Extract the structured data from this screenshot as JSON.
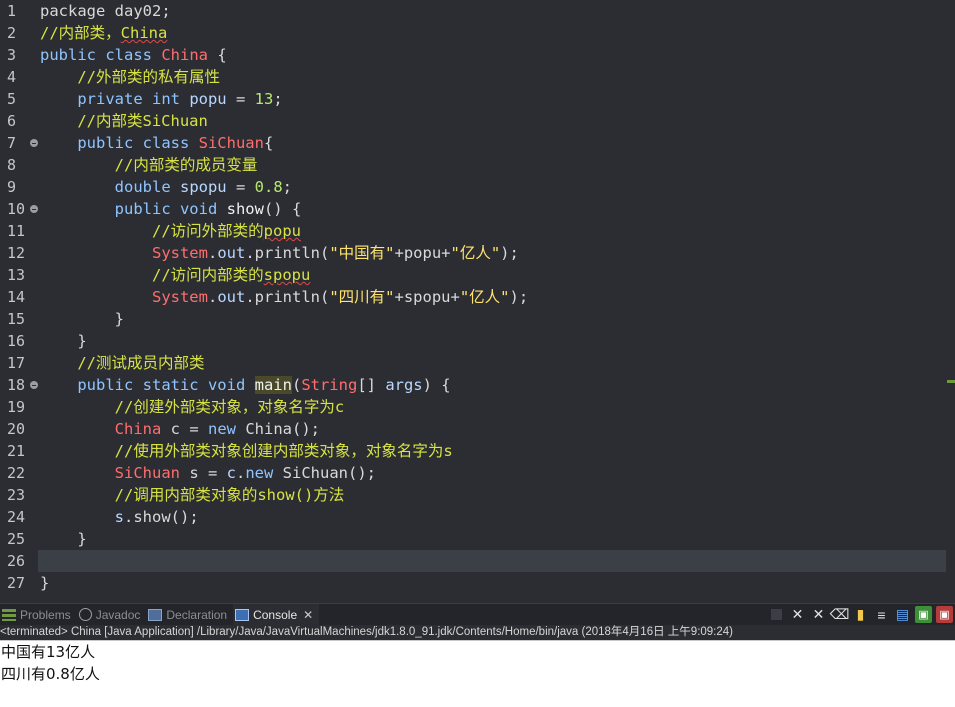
{
  "editor": {
    "lines": [
      {
        "n": "1",
        "tokens": [
          {
            "t": "package day02;",
            "c": "pl"
          }
        ]
      },
      {
        "n": "2",
        "tokens": [
          {
            "t": "//内部类，",
            "c": "cm"
          },
          {
            "t": "China",
            "c": "cm ul"
          }
        ]
      },
      {
        "n": "3",
        "tokens": [
          {
            "t": "public class ",
            "c": "kw"
          },
          {
            "t": "China",
            "c": "cls"
          },
          {
            "t": " {",
            "c": "pl"
          }
        ]
      },
      {
        "n": "4",
        "tokens": [
          {
            "t": "    //外部类的私有属性",
            "c": "cm"
          }
        ]
      },
      {
        "n": "5",
        "tokens": [
          {
            "t": "    private int ",
            "c": "kw"
          },
          {
            "t": "popu",
            "c": "var"
          },
          {
            "t": " = ",
            "c": "pl"
          },
          {
            "t": "13",
            "c": "num"
          },
          {
            "t": ";",
            "c": "pl"
          }
        ]
      },
      {
        "n": "6",
        "tokens": [
          {
            "t": "    //内部类SiChuan",
            "c": "cm"
          }
        ]
      },
      {
        "n": "7",
        "fold": true,
        "tokens": [
          {
            "t": "    public class ",
            "c": "kw"
          },
          {
            "t": "SiChuan",
            "c": "cls"
          },
          {
            "t": "{",
            "c": "pl"
          }
        ]
      },
      {
        "n": "8",
        "tokens": [
          {
            "t": "        //内部类的成员变量",
            "c": "cm"
          }
        ]
      },
      {
        "n": "9",
        "tokens": [
          {
            "t": "        double ",
            "c": "kw"
          },
          {
            "t": "spopu",
            "c": "var"
          },
          {
            "t": " = ",
            "c": "pl"
          },
          {
            "t": "0.8",
            "c": "num"
          },
          {
            "t": ";",
            "c": "pl"
          }
        ]
      },
      {
        "n": "10",
        "fold": true,
        "tokens": [
          {
            "t": "        public void ",
            "c": "kw"
          },
          {
            "t": "show",
            "c": "fn"
          },
          {
            "t": "() {",
            "c": "pl"
          }
        ]
      },
      {
        "n": "11",
        "tokens": [
          {
            "t": "            //访问外部类的",
            "c": "cm"
          },
          {
            "t": "popu",
            "c": "cm ul"
          }
        ]
      },
      {
        "n": "12",
        "tokens": [
          {
            "t": "            ",
            "c": "pl"
          },
          {
            "t": "System",
            "c": "cls"
          },
          {
            "t": ".",
            "c": "pl"
          },
          {
            "t": "out",
            "c": "var"
          },
          {
            "t": ".println(",
            "c": "pl"
          },
          {
            "t": "\"中国有\"",
            "c": "str"
          },
          {
            "t": "+popu+",
            "c": "pl"
          },
          {
            "t": "\"亿人\"",
            "c": "str"
          },
          {
            "t": ");",
            "c": "pl"
          }
        ]
      },
      {
        "n": "13",
        "tokens": [
          {
            "t": "            //访问内部类的",
            "c": "cm"
          },
          {
            "t": "spopu",
            "c": "cm ul"
          }
        ]
      },
      {
        "n": "14",
        "tokens": [
          {
            "t": "            ",
            "c": "pl"
          },
          {
            "t": "System",
            "c": "cls"
          },
          {
            "t": ".",
            "c": "pl"
          },
          {
            "t": "out",
            "c": "var"
          },
          {
            "t": ".println(",
            "c": "pl"
          },
          {
            "t": "\"四川有\"",
            "c": "str"
          },
          {
            "t": "+spopu+",
            "c": "pl"
          },
          {
            "t": "\"亿人\"",
            "c": "str"
          },
          {
            "t": ");",
            "c": "pl"
          }
        ]
      },
      {
        "n": "15",
        "tokens": [
          {
            "t": "        }",
            "c": "pl"
          }
        ]
      },
      {
        "n": "16",
        "tokens": [
          {
            "t": "    }",
            "c": "pl"
          }
        ]
      },
      {
        "n": "17",
        "tokens": [
          {
            "t": "    //测试成员内部类",
            "c": "cm"
          }
        ]
      },
      {
        "n": "18",
        "fold": true,
        "tokens": [
          {
            "t": "    public static void ",
            "c": "kw"
          },
          {
            "t": "main",
            "c": "hl"
          },
          {
            "t": "(",
            "c": "pl"
          },
          {
            "t": "String",
            "c": "cls"
          },
          {
            "t": "[] ",
            "c": "pl"
          },
          {
            "t": "args",
            "c": "var"
          },
          {
            "t": ") {",
            "c": "pl"
          }
        ]
      },
      {
        "n": "19",
        "tokens": [
          {
            "t": "        //创建外部类对象，对象名字为c",
            "c": "cm"
          }
        ]
      },
      {
        "n": "20",
        "tokens": [
          {
            "t": "        ",
            "c": "pl"
          },
          {
            "t": "China",
            "c": "cls"
          },
          {
            "t": " c = ",
            "c": "pl"
          },
          {
            "t": "new ",
            "c": "kw"
          },
          {
            "t": "China();",
            "c": "pl"
          }
        ]
      },
      {
        "n": "21",
        "tokens": [
          {
            "t": "        //使用外部类对象创建内部类对象，对象名字为s",
            "c": "cm"
          }
        ]
      },
      {
        "n": "22",
        "tokens": [
          {
            "t": "        ",
            "c": "pl"
          },
          {
            "t": "SiChuan",
            "c": "cls"
          },
          {
            "t": " s = ",
            "c": "pl"
          },
          {
            "t": "c",
            "c": "var"
          },
          {
            "t": ".",
            "c": "pl"
          },
          {
            "t": "new ",
            "c": "kw"
          },
          {
            "t": "SiChuan();",
            "c": "pl"
          }
        ]
      },
      {
        "n": "23",
        "tokens": [
          {
            "t": "        //调用内部类对象的show()方法",
            "c": "cm"
          }
        ]
      },
      {
        "n": "24",
        "tokens": [
          {
            "t": "        ",
            "c": "pl"
          },
          {
            "t": "s",
            "c": "var"
          },
          {
            "t": ".show();",
            "c": "pl"
          }
        ]
      },
      {
        "n": "25",
        "tokens": [
          {
            "t": "    }",
            "c": "pl"
          }
        ]
      },
      {
        "n": "26",
        "current": true,
        "tokens": [
          {
            "t": "",
            "c": "pl"
          }
        ]
      },
      {
        "n": "27",
        "tokens": [
          {
            "t": "}",
            "c": "pl"
          }
        ]
      }
    ]
  },
  "console_tabs": {
    "problems": "Problems",
    "javadoc": "Javadoc",
    "declaration": "Declaration",
    "console": "Console",
    "close_glyph": "✕"
  },
  "console_tools": {
    "terminate": "■",
    "remove": "✕",
    "remove_all": "✕",
    "clear": "⌫",
    "scroll_lock": "🔒",
    "word_wrap": "≡",
    "pin": "▤",
    "display": "▣",
    "open": "▣"
  },
  "console": {
    "status": "<terminated> China [Java Application] /Library/Java/JavaVirtualMachines/jdk1.8.0_91.jdk/Contents/Home/bin/java (2018年4月16日 上午9:09:24)",
    "output": [
      "中国有13亿人",
      "四川有0.8亿人"
    ]
  },
  "colors": {
    "editor_bg": "#2b2d33",
    "comment": "#d7e343",
    "keyword": "#8fc5ff",
    "class": "#ff6e6e",
    "number": "#b7e86e",
    "string": "#ffe36b"
  }
}
